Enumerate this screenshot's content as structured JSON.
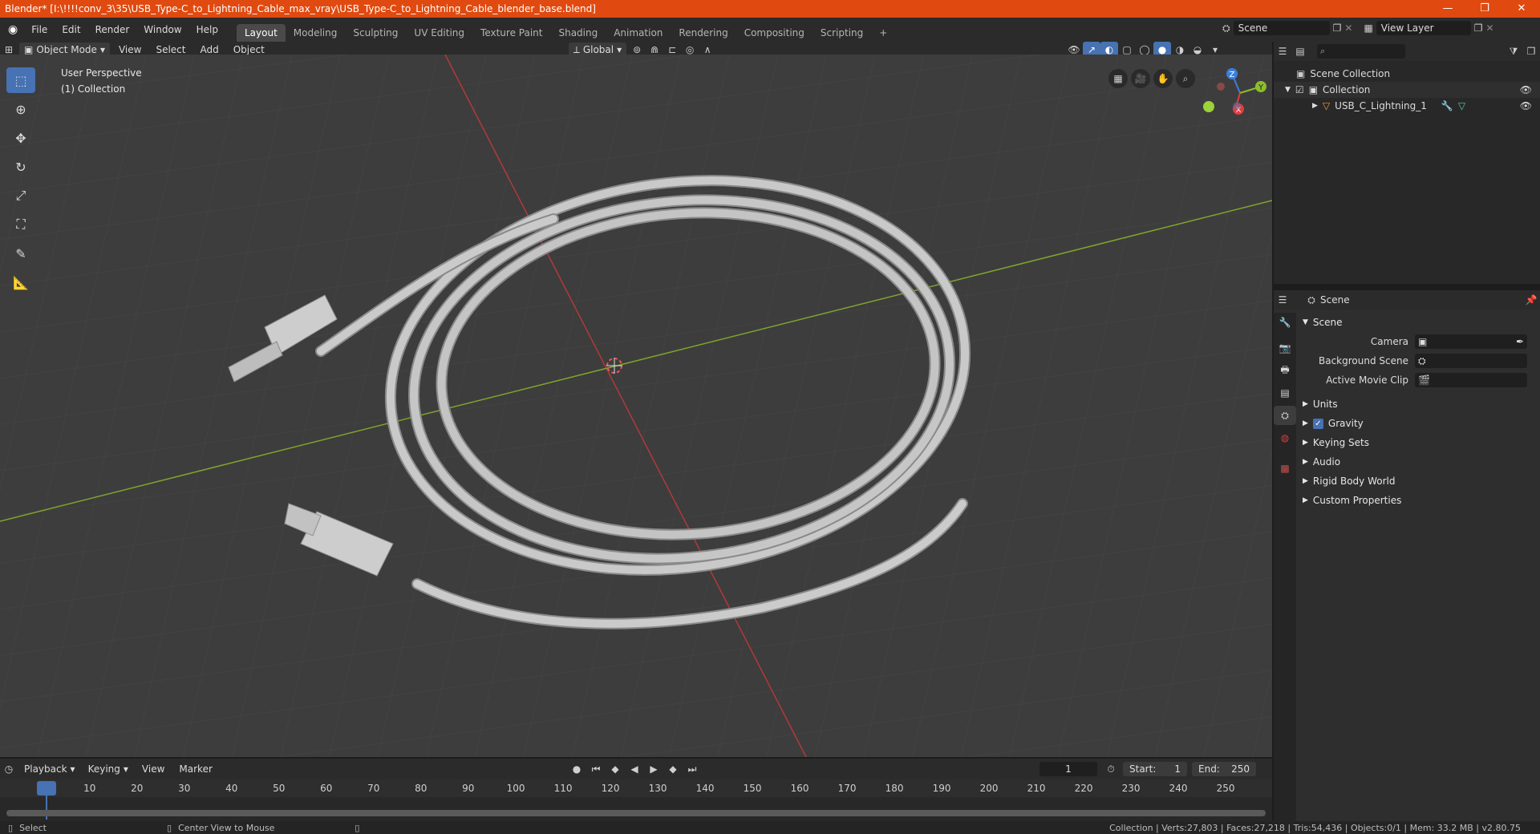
{
  "window": {
    "title": "Blender* [I:\\!!!!conv_3\\35\\USB_Type-C_to_Lightning_Cable_max_vray\\USB_Type-C_to_Lightning_Cable_blender_base.blend]",
    "minimize": "—",
    "maximize": "❐",
    "close": "✕"
  },
  "menu": {
    "items": [
      "File",
      "Edit",
      "Render",
      "Window",
      "Help"
    ],
    "workspaces": [
      "Layout",
      "Modeling",
      "Sculpting",
      "UV Editing",
      "Texture Paint",
      "Shading",
      "Animation",
      "Rendering",
      "Compositing",
      "Scripting"
    ],
    "active_workspace": "Layout",
    "add_tab": "+",
    "scene_label": "Scene",
    "view_layer_label": "View Layer"
  },
  "viewport_header": {
    "mode": "Object Mode",
    "menus": [
      "View",
      "Select",
      "Add",
      "Object"
    ],
    "orientation": "Global"
  },
  "viewport": {
    "perspective_label": "User Perspective",
    "collection_label": "(1) Collection",
    "gizmo_axes": [
      "Z",
      "Y",
      "X"
    ]
  },
  "outliner": {
    "search_placeholder": "",
    "scene_collection": "Scene Collection",
    "collection": "Collection",
    "object": "USB_C_Lightning_1"
  },
  "properties": {
    "context": "Scene",
    "panel_title": "Scene",
    "camera_label": "Camera",
    "background_scene_label": "Background Scene",
    "active_movie_clip_label": "Active Movie Clip",
    "sections": [
      "Units",
      "Gravity",
      "Keying Sets",
      "Audio",
      "Rigid Body World",
      "Custom Properties"
    ],
    "gravity_checked": true
  },
  "timeline": {
    "menus": [
      "Playback",
      "Keying",
      "View",
      "Marker"
    ],
    "current_frame": "1",
    "start_label": "Start:",
    "start": "1",
    "end_label": "End:",
    "end": "250",
    "ruler": [
      "1",
      "10",
      "20",
      "30",
      "40",
      "50",
      "60",
      "70",
      "80",
      "90",
      "100",
      "110",
      "120",
      "130",
      "140",
      "150",
      "160",
      "170",
      "180",
      "190",
      "200",
      "210",
      "220",
      "230",
      "240",
      "250"
    ]
  },
  "statusbar": {
    "select": "Select",
    "center_view": "Center View to Mouse",
    "stats": "Collection | Verts:27,803 | Faces:27,218 | Tris:54,436 | Objects:0/1 | Mem: 33.2 MB | v2.80.75"
  },
  "colors": {
    "titlebar": "#e04a10",
    "accent": "#4772b3",
    "x_axis": "#e23c3c",
    "y_axis": "#8cbf2a",
    "z_axis": "#3a7fe0"
  }
}
